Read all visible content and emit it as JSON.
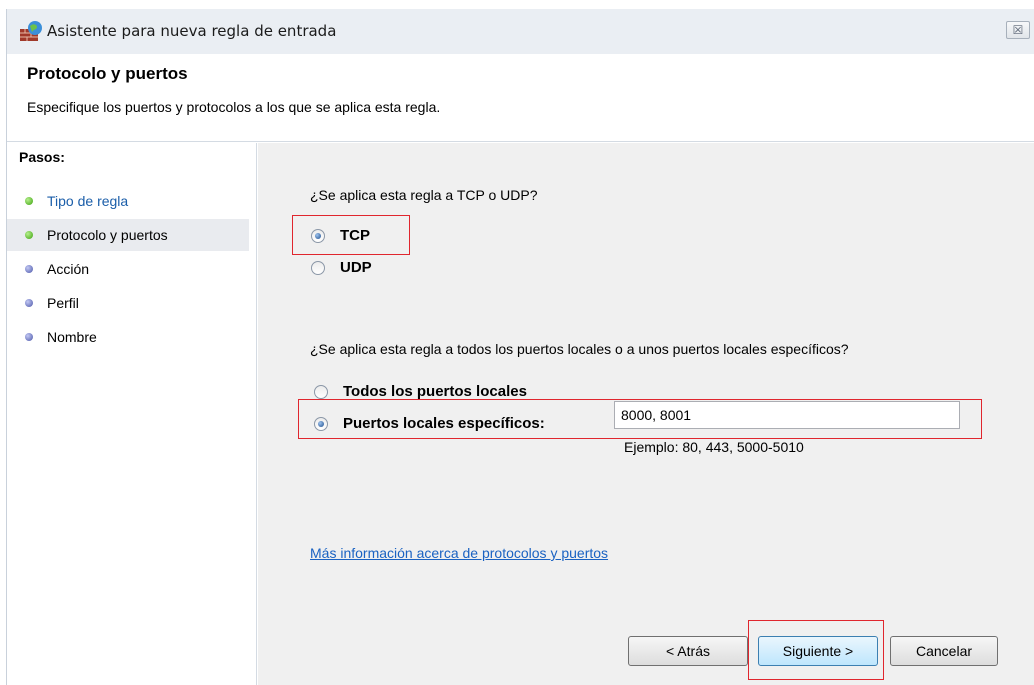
{
  "window": {
    "title": "Asistente para nueva regla de entrada",
    "close_glyph": "☒"
  },
  "header": {
    "title": "Protocolo y puertos",
    "subtitle": "Especifique los puertos y protocolos a los que se aplica esta regla."
  },
  "steps": {
    "heading": "Pasos:",
    "items": [
      {
        "label": "Tipo de regla",
        "state": "link",
        "dot": "green"
      },
      {
        "label": "Protocolo y puertos",
        "state": "active",
        "dot": "green"
      },
      {
        "label": "Acción",
        "state": "pending",
        "dot": "blue"
      },
      {
        "label": "Perfil",
        "state": "pending",
        "dot": "blue"
      },
      {
        "label": "Nombre",
        "state": "pending",
        "dot": "blue"
      }
    ]
  },
  "protocol": {
    "question": "¿Se aplica esta regla a TCP o UDP?",
    "options": [
      {
        "label": "TCP",
        "selected": true
      },
      {
        "label": "UDP",
        "selected": false
      }
    ]
  },
  "ports": {
    "question": "¿Se aplica esta regla a todos los puertos locales o a unos puertos locales específicos?",
    "options": [
      {
        "label": "Todos los puertos locales",
        "selected": false
      },
      {
        "label": "Puertos locales específicos:",
        "selected": true
      }
    ],
    "value": "8000, 8001",
    "example": "Ejemplo: 80, 443, 5000-5010"
  },
  "more_info_link": "Más información acerca de protocolos y puertos",
  "buttons": {
    "back": "< Atrás",
    "next": "Siguiente >",
    "cancel": "Cancelar"
  },
  "colors": {
    "highlight": "#e0262e",
    "link": "#1a62c2",
    "content_bg": "#f0f0f0"
  }
}
